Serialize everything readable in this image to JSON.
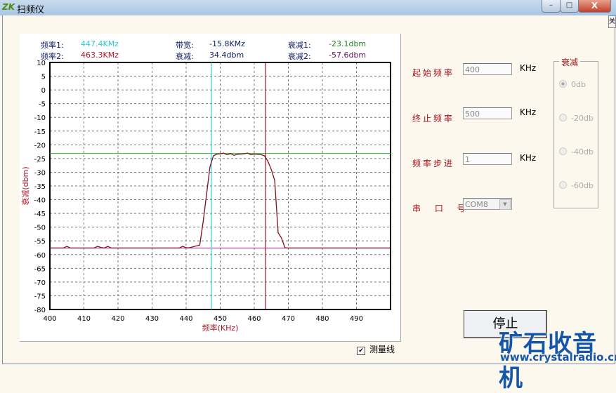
{
  "window": {
    "title": "扫频仪",
    "minimize": "–",
    "maximize": "□",
    "close": "X",
    "side_tab": "关"
  },
  "readouts": {
    "freq1_label": "频率1:",
    "freq1_value": "447.4KMz",
    "freq2_label": "频率2:",
    "freq2_value": "463.3KMz",
    "bw_label": "带宽:",
    "bw_value": "-15.8KMz",
    "att_label": "衰减:",
    "att_value": "34.4dbm",
    "att1_label": "衰减1:",
    "att1_value": "-23.1dbm",
    "att2_label": "衰减2:",
    "att2_value": "-57.6dbm"
  },
  "colors": {
    "cursor1": "#30d0e0",
    "cursor2": "#a01828",
    "level1": "#30c040",
    "level2": "#c02080",
    "trace": "#801020"
  },
  "controls": {
    "start_label": "起始频率",
    "start_value": "400",
    "start_unit": "KHz",
    "stop_label": "终止频率",
    "stop_value": "500",
    "stop_unit": "KHz",
    "step_label": "频率步进",
    "step_value": "1",
    "step_unit": "KHz",
    "port_label": "串 口 号",
    "port_value": "COM8",
    "att_group": "衰减",
    "att_options": [
      "0db",
      "-20db",
      "-40db",
      "-60db"
    ],
    "att_selected": "0db",
    "stop_button": "停止",
    "measure_line_label": "测量线",
    "measure_line_checked": true
  },
  "watermark": {
    "cn": "矿石收音机",
    "url": "www.crystalradio.cn"
  },
  "chart_data": {
    "type": "line",
    "xlabel": "频率(KHz)",
    "ylabel": "衰减(dbm)",
    "xlim": [
      400,
      500
    ],
    "ylim": [
      -80,
      10
    ],
    "xticks": [
      400,
      410,
      420,
      430,
      440,
      450,
      460,
      470,
      480,
      490
    ],
    "yticks": [
      10,
      5,
      0,
      -5,
      -10,
      -15,
      -20,
      -25,
      -30,
      -35,
      -40,
      -45,
      -50,
      -55,
      -60,
      -65,
      -70,
      -75,
      -80
    ],
    "grid": true,
    "cursors_x": [
      447.4,
      463.3
    ],
    "levels_y": [
      -23.1,
      -57.6
    ],
    "series": [
      {
        "name": "trace",
        "x": [
          400,
          404,
          405,
          406,
          413,
          414,
          415,
          416,
          417,
          418,
          438,
          439,
          440,
          441,
          444,
          445,
          446,
          447,
          448,
          449,
          450,
          451,
          452,
          453,
          454,
          455,
          456,
          457,
          458,
          459,
          460,
          461,
          462,
          463,
          464,
          465,
          466,
          467,
          468,
          469,
          470,
          500
        ],
        "y": [
          -57.6,
          -57.6,
          -57.0,
          -57.6,
          -57.6,
          -57.0,
          -57.4,
          -57.6,
          -57.0,
          -57.6,
          -57.6,
          -57.0,
          -57.5,
          -57.5,
          -56.5,
          -48,
          -38,
          -28,
          -24,
          -23.4,
          -23.3,
          -23.0,
          -23.6,
          -23.2,
          -23.8,
          -23.5,
          -23.4,
          -23.3,
          -23.0,
          -23.6,
          -23.4,
          -23.5,
          -23.6,
          -24,
          -26,
          -29,
          -33,
          -52,
          -54,
          -57.5,
          -57.6,
          -57.6
        ]
      }
    ]
  }
}
